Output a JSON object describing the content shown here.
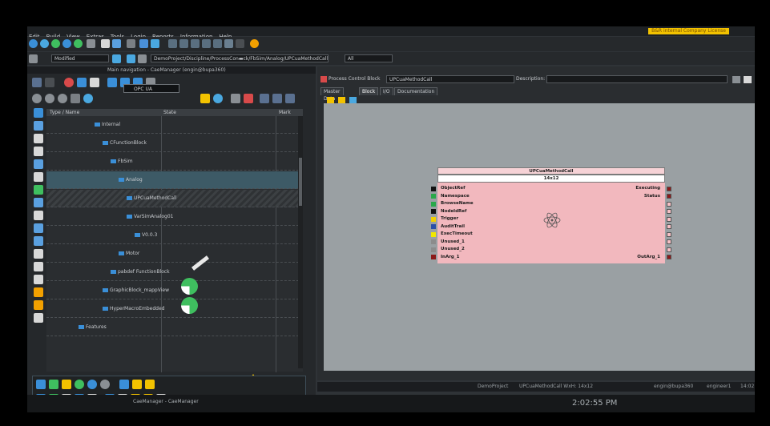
{
  "menu": [
    "Edit",
    "Build",
    "View",
    "Extras",
    "Tools",
    "Login",
    "Reports",
    "Information",
    "Help"
  ],
  "license": "B&R internal Company License",
  "toolbar2": {
    "mode": "Modified",
    "path": "DemoProject/Discipline/ProcessCon▬ck/FbSim/Analog/UPCuaMethodCall",
    "filter": "All"
  },
  "nav": {
    "title": "Main navigation - CaeManager (engin@bupa360)",
    "search": "OPC UA",
    "columns": {
      "name": "Type / Name",
      "state": "State",
      "mark": "Mark"
    },
    "rows": [
      {
        "label": "Internal",
        "indent": 60
      },
      {
        "label": "CFunctionBlock",
        "indent": 70
      },
      {
        "label": "FbSim",
        "indent": 80
      },
      {
        "label": "Analog",
        "indent": 90
      },
      {
        "label": "UPCuaMethodCall",
        "indent": 100
      },
      {
        "label": "VarSimAnalog01",
        "indent": 100
      },
      {
        "label": "V0.0.3",
        "indent": 110
      },
      {
        "label": "Motor",
        "indent": 90
      },
      {
        "label": "pabdef FunctionBlock",
        "indent": 80
      },
      {
        "label": "GraphicBlock_mappView",
        "indent": 70
      },
      {
        "label": "HyperMacroEmbedded",
        "indent": 70
      },
      {
        "label": "Features",
        "indent": 40
      }
    ]
  },
  "pcb": {
    "label": "Process Control Block",
    "value": "UPCuaMethodCall",
    "desc_label": "Description:"
  },
  "tabs": [
    "Master Data",
    "Block",
    "I/O",
    "Documentation"
  ],
  "block": {
    "title": "UPCuaMethodCall",
    "size": "14x12",
    "inputs": [
      {
        "name": "ObjectRef",
        "color": "#111111"
      },
      {
        "name": "Namespace",
        "color": "#2aa84a"
      },
      {
        "name": "BrowseName",
        "color": "#2aa84a"
      },
      {
        "name": "NodeIdRef",
        "color": "#111111"
      },
      {
        "name": "Trigger",
        "color": "#f2d000"
      },
      {
        "name": "AuditTrail",
        "color": "#2b4fa8"
      },
      {
        "name": "ExecTimeout",
        "color": "#f2e800"
      },
      {
        "name": "Unused_1",
        "color": "#8c8c8c"
      },
      {
        "name": "Unused_2",
        "color": "#8c8c8c"
      },
      {
        "name": "InArg_1",
        "color": "#8c1a1a"
      }
    ],
    "outputs": [
      {
        "name": "Executing",
        "color": "#8c1a1a"
      },
      {
        "name": "Status",
        "color": "#8c1a1a"
      },
      {
        "name": "",
        "color": "#f5c0c5"
      },
      {
        "name": "",
        "color": "#f5c0c5"
      },
      {
        "name": "",
        "color": "#f5c0c5"
      },
      {
        "name": "",
        "color": "#f5c0c5"
      },
      {
        "name": "",
        "color": "#f5c0c5"
      },
      {
        "name": "",
        "color": "#f5c0c5"
      },
      {
        "name": "",
        "color": "#f5c0c5"
      },
      {
        "name": "OutArg_1",
        "color": "#8c1a1a"
      }
    ]
  },
  "status": {
    "project": "DemoProject",
    "block": "UPCuaMethodCall WxH: 14x12",
    "user": "engin@bupa360",
    "login": "engineer1",
    "time": "14:02"
  },
  "taskbar": {
    "app": "CaeManager - CaeManager",
    "clock": "2:02:55 PM"
  }
}
